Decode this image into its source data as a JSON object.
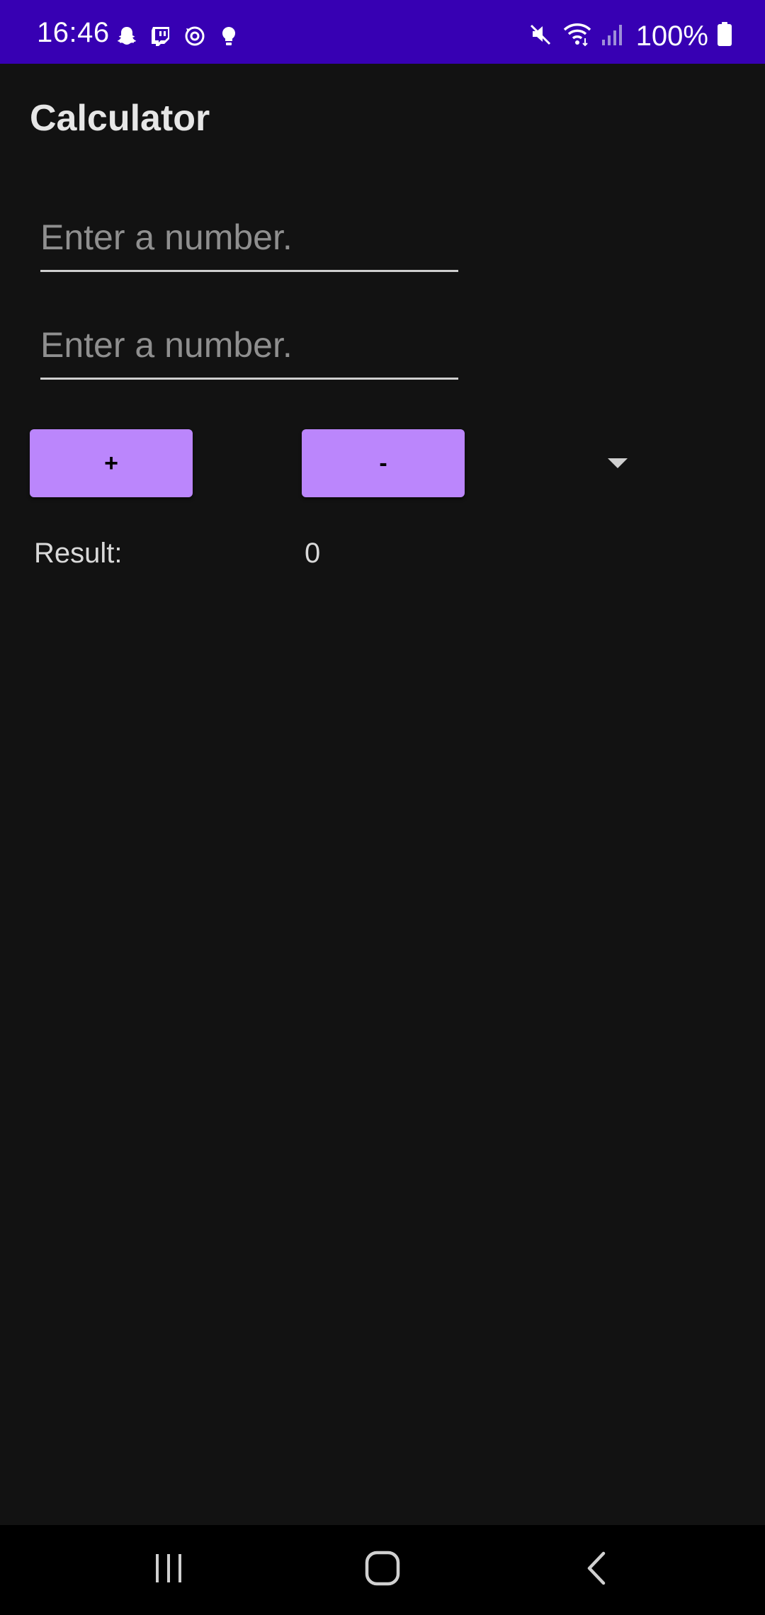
{
  "status_bar": {
    "time": "16:46",
    "battery_percent": "100%",
    "background_color": "#3700b3",
    "left_icons": [
      "snapchat-icon",
      "twitch-icon",
      "sync-icon",
      "lightbulb-icon"
    ],
    "right_icons": [
      "mute-icon",
      "wifi-icon",
      "signal-icon",
      "battery-icon"
    ]
  },
  "app": {
    "title": "Calculator"
  },
  "inputs": {
    "first_placeholder": "Enter a number.",
    "first_value": "",
    "second_placeholder": "Enter a number.",
    "second_value": ""
  },
  "buttons": {
    "add_label": "+",
    "subtract_label": "-",
    "accent_color": "#bb86fc"
  },
  "dropdown": {
    "selected_value": ""
  },
  "result": {
    "label": "Result:",
    "value": "0"
  },
  "navigation_bar": {
    "buttons": [
      "recents-icon",
      "home-icon",
      "back-icon"
    ]
  }
}
